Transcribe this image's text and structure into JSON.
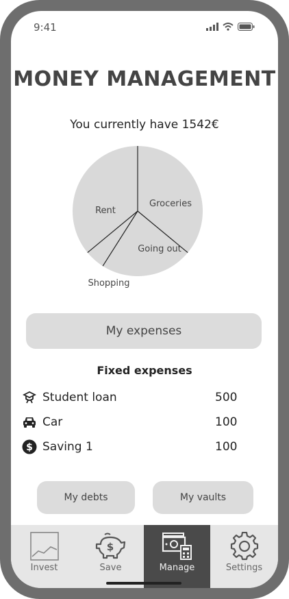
{
  "status_bar": {
    "time": "9:41"
  },
  "header": {
    "title": "MONEY MANAGEMENT"
  },
  "balance": {
    "text": "You currently have 1542€"
  },
  "chart_data": {
    "type": "pie",
    "slices": [
      {
        "label": "Groceries",
        "value": 36
      },
      {
        "label": "Going out",
        "value": 23
      },
      {
        "label": "Shopping",
        "value": 5
      },
      {
        "label": "Rent",
        "value": 36
      }
    ]
  },
  "main": {
    "expenses_button": "My expenses",
    "fixed_title": "Fixed expenses",
    "fixed_expenses": [
      {
        "label": "Student loan",
        "amount": "500",
        "icon": "graduate-icon"
      },
      {
        "label": "Car",
        "amount": "100",
        "icon": "car-icon"
      },
      {
        "label": "Saving 1",
        "amount": "100",
        "icon": "dollar-coin-icon"
      }
    ],
    "debts_button": "My debts",
    "vaults_button": "My vaults"
  },
  "tabbar": {
    "active": "Manage",
    "tabs": [
      {
        "label": "Invest",
        "icon": "line-chart-icon"
      },
      {
        "label": "Save",
        "icon": "piggy-bank-icon"
      },
      {
        "label": "Manage",
        "icon": "money-calculator-icon"
      },
      {
        "label": "Settings",
        "icon": "gear-icon"
      }
    ]
  },
  "colors": {
    "frame": "#6e6e6e",
    "button": "#dcdcdc",
    "pie": "#d9d9d9",
    "active_tab": "#4a4a4a",
    "tabbar": "#e6e6e6"
  }
}
